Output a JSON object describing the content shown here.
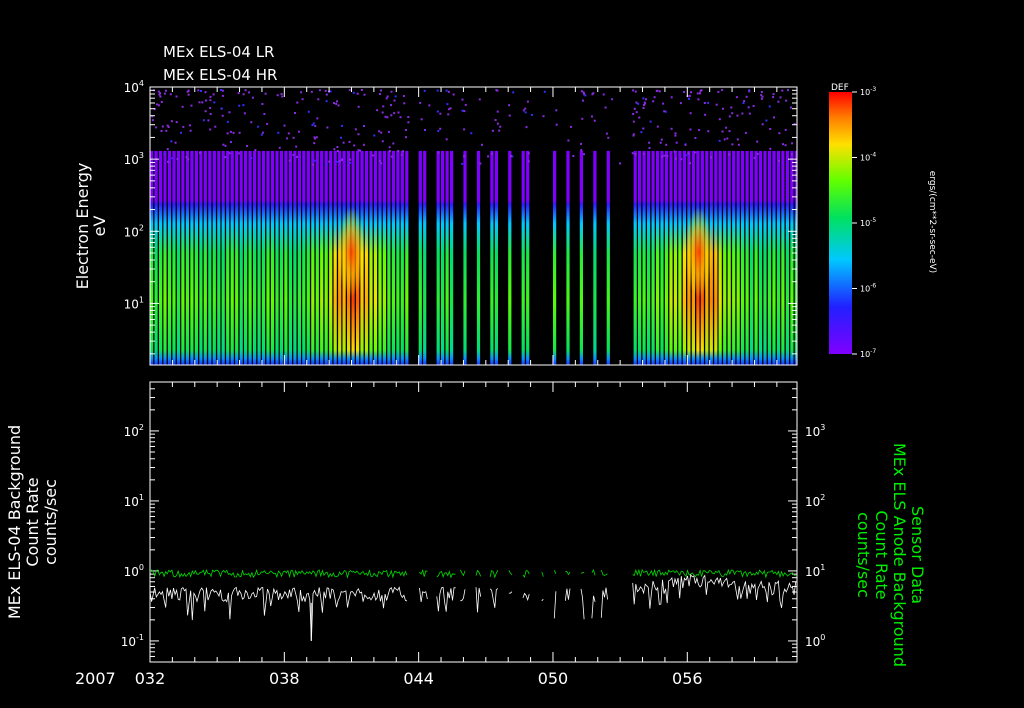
{
  "titles": [
    "MEx ELS-04 LR",
    "MEx ELS-04 HR"
  ],
  "colors": {
    "background": "#000000",
    "axis": "#ffffff",
    "primary_series": "#ffffff",
    "secondary_series": "#00dd00",
    "secondary_label": "#00ee00"
  },
  "chart_data": [
    {
      "type": "heatmap",
      "title": "MEx ELS-04 LR / MEx ELS-04 HR",
      "ylabel": "Electron Energy",
      "yunit": "eV",
      "yscale": "log",
      "ylim": [
        1.4,
        10000
      ],
      "ytick_labels": [
        "10^1",
        "10^2",
        "10^3",
        "10^4"
      ],
      "xlim": [
        32,
        60.9
      ],
      "colorbar": {
        "title": "DEF",
        "unit_label": "ergs/(cm**2-sr-sec-eV)",
        "range": [
          1e-07,
          0.001
        ],
        "tick_labels": [
          "10^-3",
          "10^-4",
          "10^-5",
          "10^-6",
          "10^-7"
        ]
      },
      "data_gaps_doy": [
        [
          43.5,
          44.0
        ],
        [
          44.4,
          44.8
        ],
        [
          45.6,
          45.9
        ],
        [
          46.1,
          46.5
        ],
        [
          46.8,
          47.2
        ],
        [
          47.6,
          48.0
        ],
        [
          48.2,
          48.6
        ],
        [
          48.9,
          49.5
        ],
        [
          49.6,
          50.0
        ],
        [
          50.2,
          50.6
        ],
        [
          50.8,
          51.2
        ],
        [
          51.4,
          51.7
        ],
        [
          51.9,
          52.3
        ],
        [
          52.5,
          53.5
        ]
      ],
      "intensity_peaks_doy": [
        41.0,
        56.5
      ]
    },
    {
      "type": "line",
      "left_ylabel": [
        "MEx ELS-04 Background",
        "Count Rate",
        "counts/sec"
      ],
      "right_ylabel": [
        "Sensor Data",
        "MEx ELS Anode Background",
        "Count Rate",
        "counts/sec"
      ],
      "yscale": "log",
      "left_ylim": [
        0.05,
        500
      ],
      "right_ylim": [
        0.5,
        5000
      ],
      "left_ytick_labels": [
        "10^-1",
        "10^0",
        "10^1",
        "10^2"
      ],
      "right_ytick_labels": [
        "10^0",
        "10^1",
        "10^2",
        "10^3"
      ],
      "xlabel_year": "2007",
      "x_tick_labels": [
        "032",
        "038",
        "044",
        "050",
        "056"
      ],
      "x_tick_values": [
        32,
        38,
        44,
        50,
        56
      ],
      "xlim": [
        32,
        60.9
      ],
      "series": [
        {
          "axis": "left",
          "baseline": 0.45,
          "dropout_doy": 39.2,
          "dropout_value": 0.1
        },
        {
          "axis": "right",
          "baseline": 9.0
        }
      ]
    }
  ]
}
